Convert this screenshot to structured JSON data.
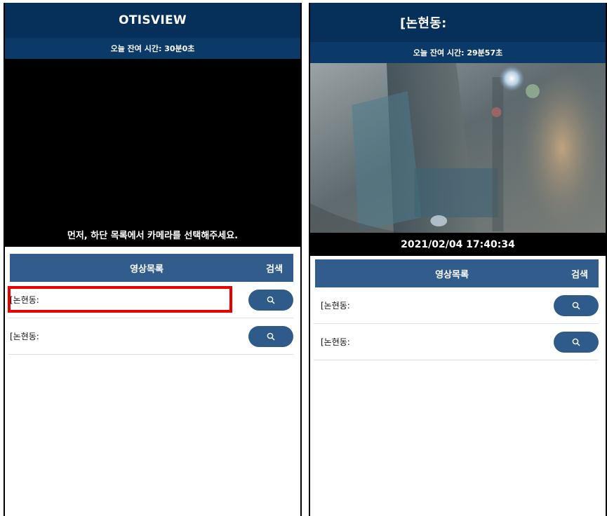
{
  "left_panel": {
    "title": "OTISVIEW",
    "remaining_time": "오늘 잔여 시간: 30분0초",
    "video_message": "먼저, 하단 목록에서 카메라를 선택해주세요.",
    "list_header": {
      "video_list": "영상목록",
      "search": "검색"
    },
    "rows": [
      {
        "label": "[논현동:",
        "highlighted": true
      },
      {
        "label": "[논현동:"
      }
    ]
  },
  "right_panel": {
    "title": "[논현동:",
    "remaining_time": "오늘 잔여 시간: 29분57초",
    "timestamp": "2021/02/04 17:40:34",
    "list_header": {
      "video_list": "영상목록",
      "search": "검색"
    },
    "rows": [
      {
        "label": "[논현동:"
      },
      {
        "label": "[논현동:"
      }
    ]
  },
  "colors": {
    "title_bar": "#062f5a",
    "sub_bar": "#0c3a68",
    "list_header": "#325c8c",
    "search_button": "#2f5b8b",
    "highlight": "#e60000"
  },
  "icons": {
    "search_button": "search-icon"
  }
}
